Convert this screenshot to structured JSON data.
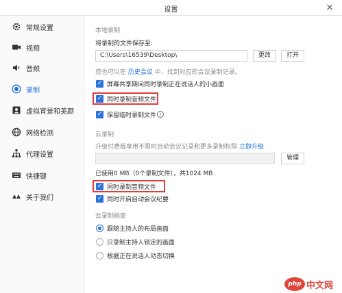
{
  "window": {
    "title": "设置",
    "close": "×"
  },
  "sidebar": {
    "items": [
      {
        "label": "常规设置",
        "icon": "gear-icon"
      },
      {
        "label": "视频",
        "icon": "video-camera-icon"
      },
      {
        "label": "音频",
        "icon": "speaker-icon"
      },
      {
        "label": "录制",
        "icon": "record-icon",
        "active": true
      },
      {
        "label": "虚拟背景和美颜",
        "icon": "portrait-icon"
      },
      {
        "label": "网络检测",
        "icon": "globe-icon"
      },
      {
        "label": "代理设置",
        "icon": "network-tree-icon"
      },
      {
        "label": "快捷键",
        "icon": "keyboard-icon"
      },
      {
        "label": "关于我们",
        "icon": "logo-icon"
      }
    ]
  },
  "local": {
    "section_title": "本地录制",
    "save_to_label": "将录制的文件保存至:",
    "path_value": "C:\\Users\\16539\\Desktop\\",
    "change_button": "更改",
    "open_button": "打开",
    "hint_prefix": "您也可以在",
    "hint_link": "历史会议",
    "hint_suffix": "中，找到对应的会议录制记录。",
    "options": [
      {
        "label": "屏幕共享期间同时录制正在说话人的小画面",
        "checked": true
      },
      {
        "label": "同时录制音频文件",
        "checked": true
      },
      {
        "label": "保留临时录制文件",
        "checked": true
      }
    ]
  },
  "cloud": {
    "section_title": "云录制",
    "upgrade_hint": "升级付费版享用不限时自动会议记录和更多录制权限",
    "upgrade_link": "立即升级",
    "manage_button": "管理",
    "usage_text": "已使用0 MB（0个录制文件），共1024 MB",
    "options": [
      {
        "label": "同时录制音频文件",
        "checked": true
      },
      {
        "label": "同时开启自动会议纪要",
        "checked": true
      }
    ]
  },
  "layout": {
    "section_title": "云录制画面",
    "options": [
      {
        "label": "跟随主持人的布局画面",
        "selected": true
      },
      {
        "label": "只录制主持人锁定的画面",
        "selected": false
      },
      {
        "label": "根据正在说话人动态切换",
        "selected": false
      }
    ]
  },
  "watermark": {
    "badge": "php",
    "text": "中文网"
  },
  "colors": {
    "accent": "#2b73d8",
    "highlight": "#e03a3a",
    "link": "#1a6fe0"
  }
}
